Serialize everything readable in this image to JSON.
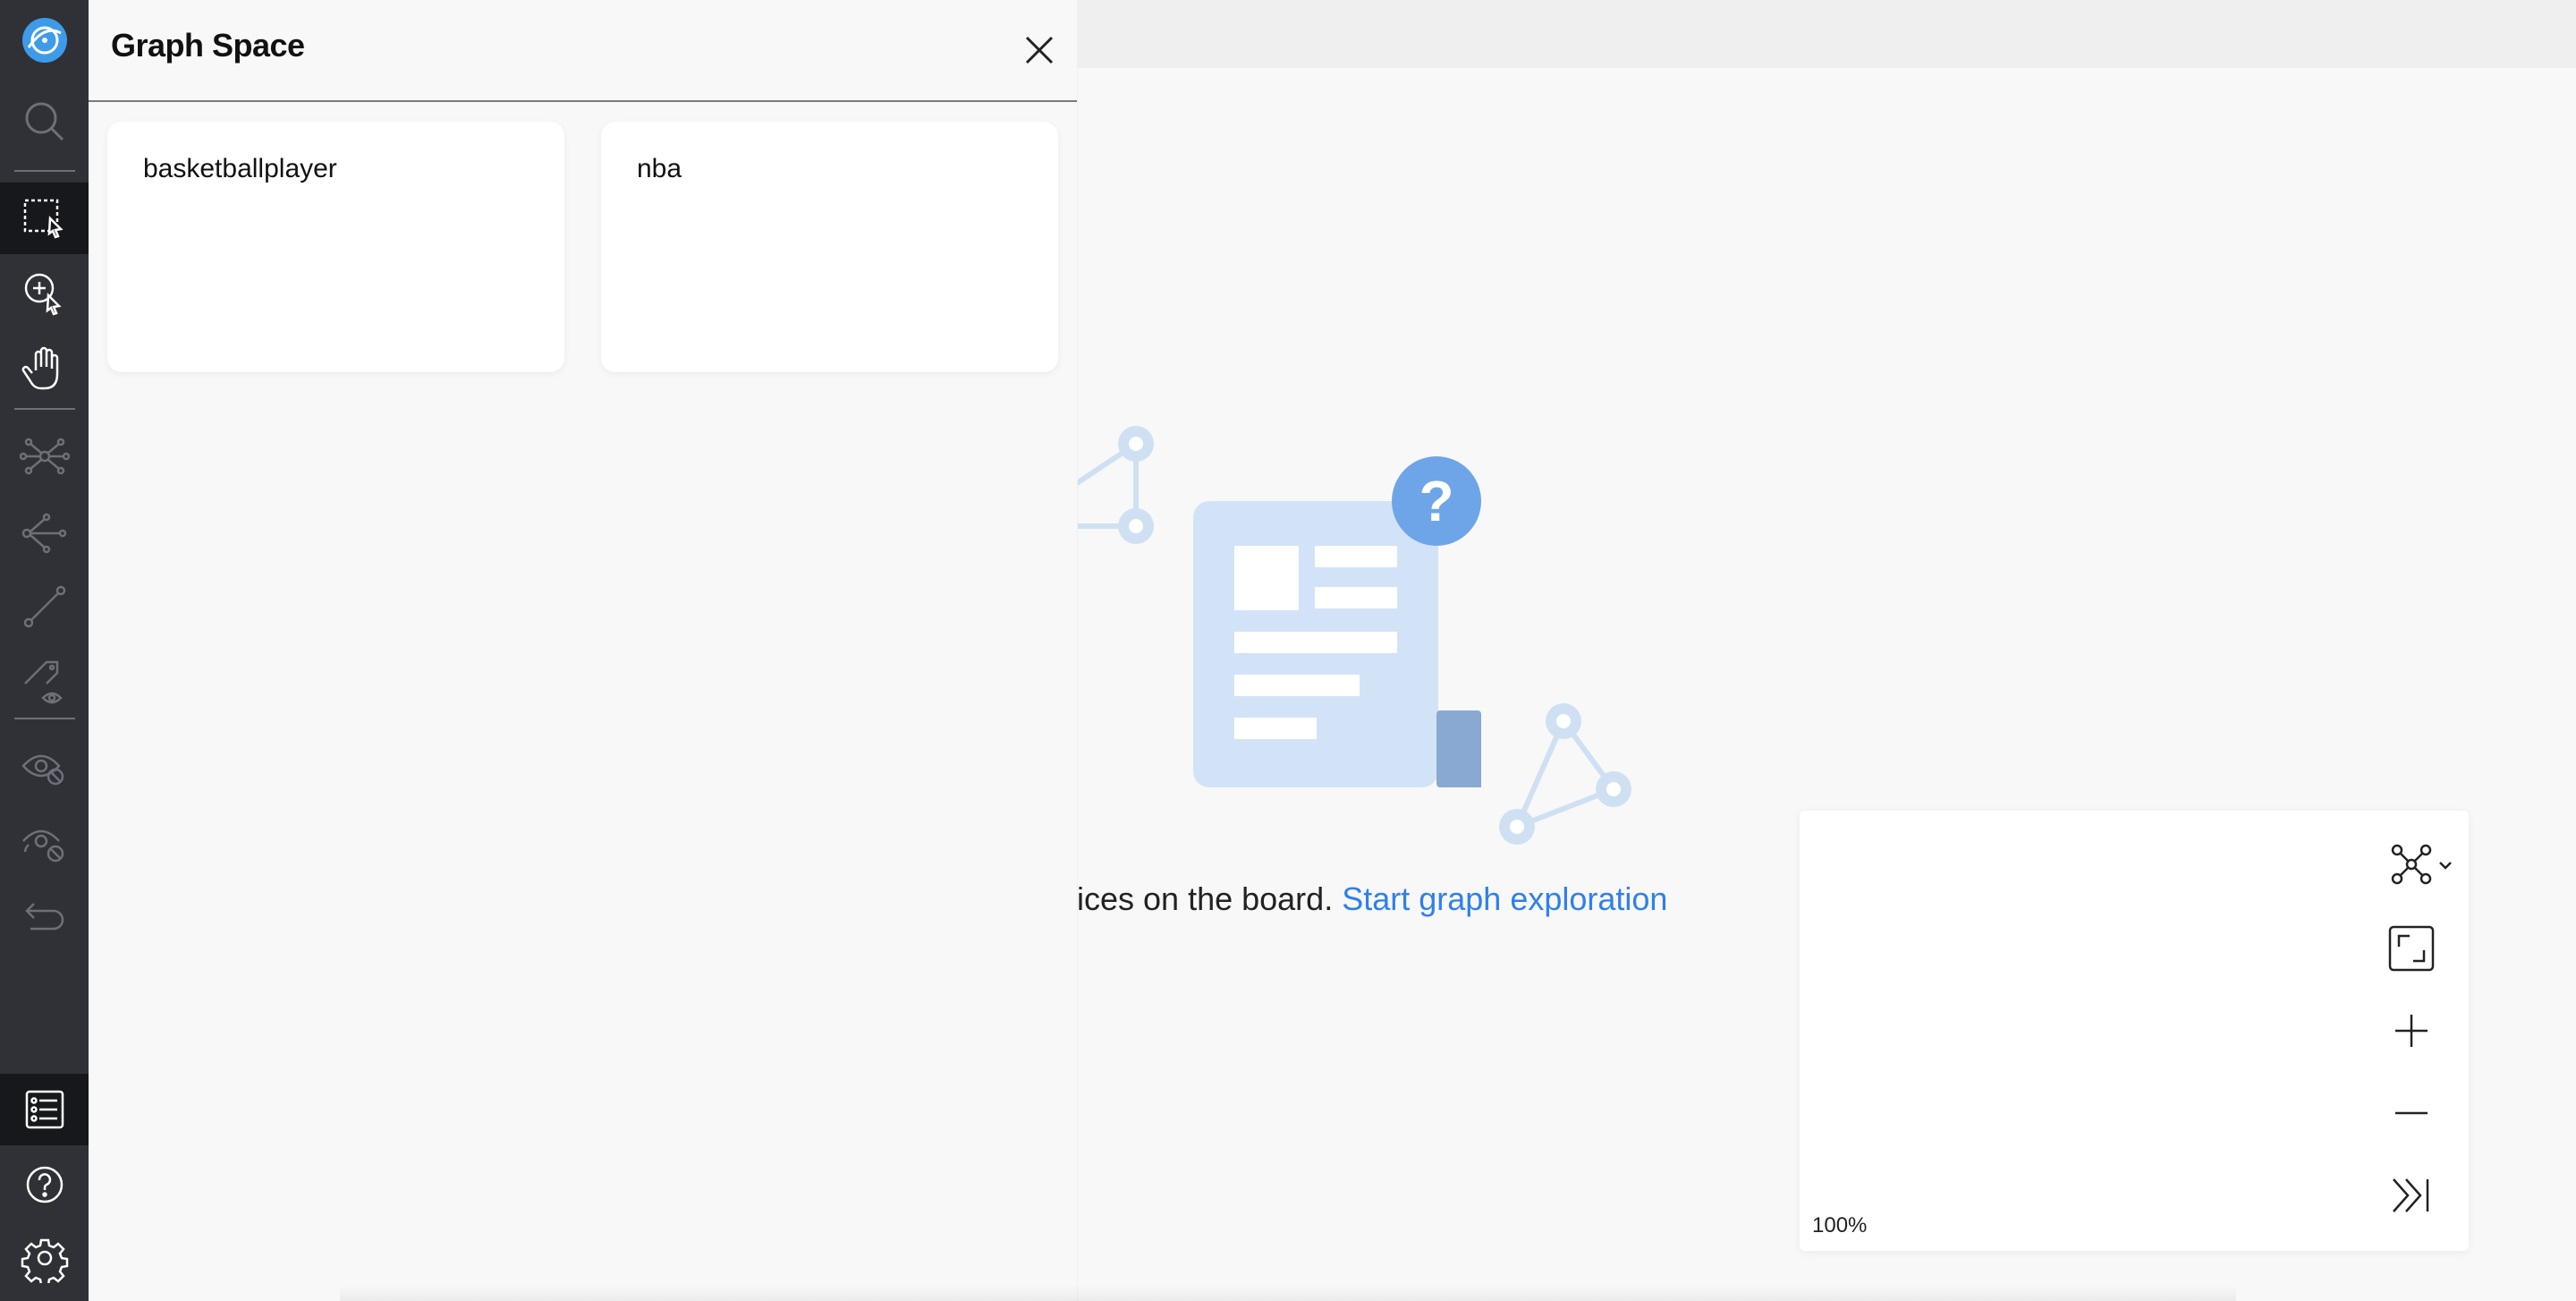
{
  "drawer": {
    "title": "Graph Space",
    "spaces": [
      "basketballplayer",
      "nba"
    ]
  },
  "empty_state": {
    "text": "ices on the board.",
    "link": "Start graph exploration"
  },
  "zoom_panel": {
    "zoom_level": "100%"
  },
  "colors": {
    "sidebar": "#2f3136",
    "sidebar_active": "#17181b",
    "accent_link": "#2f80ed",
    "logo": "#3d9be9"
  },
  "toolbar_icons": [
    "logo-icon",
    "search-icon",
    "select-box-icon",
    "zoom-select-icon",
    "pan-hand-icon",
    "expand-graph-icon",
    "common-neighbor-icon",
    "find-path-icon",
    "show-tags-icon",
    "hide-icon",
    "hide-others-icon",
    "undo-icon",
    "graph-space-icon",
    "help-icon",
    "settings-icon"
  ]
}
